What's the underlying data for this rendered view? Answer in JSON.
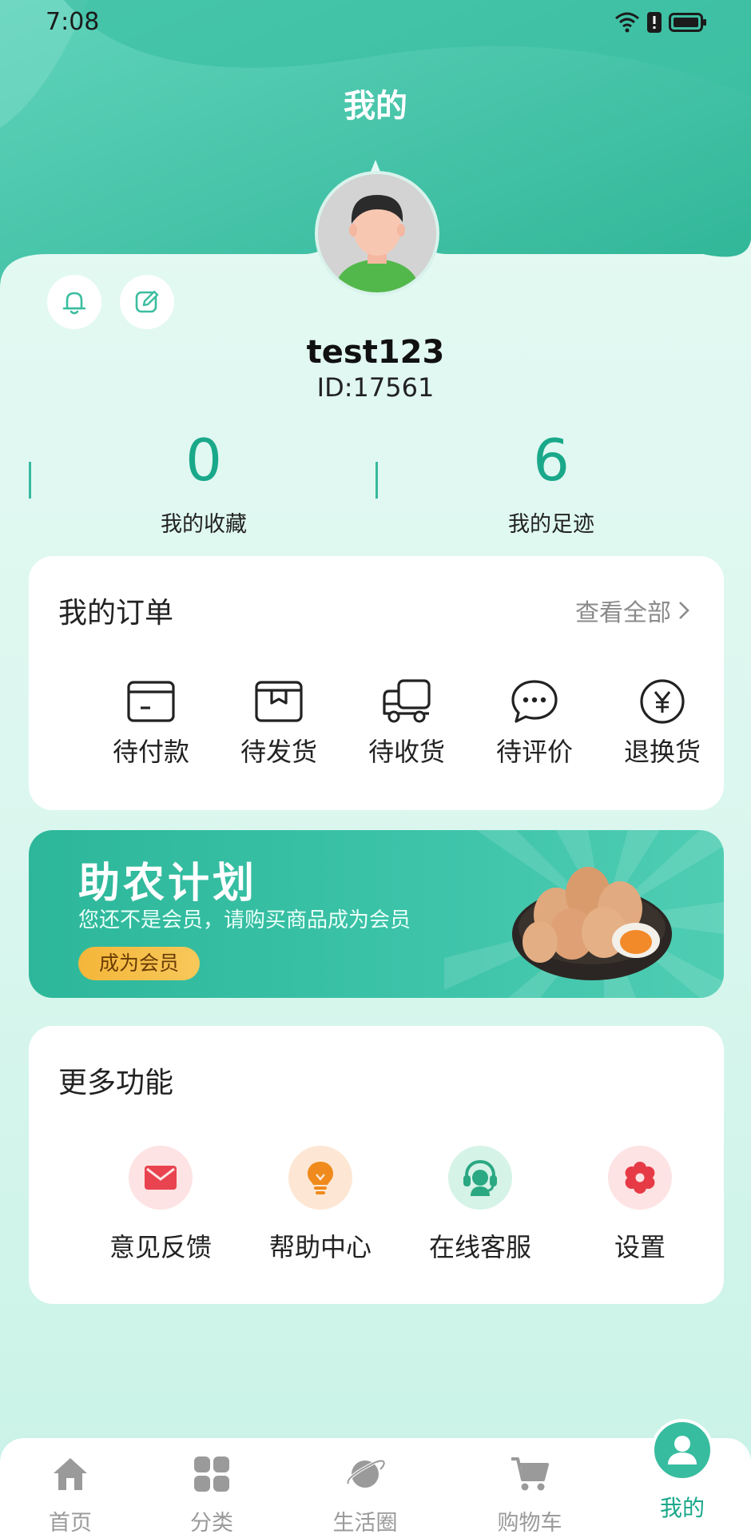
{
  "status_bar": {
    "time": "7:08"
  },
  "header": {
    "title": "我的"
  },
  "profile": {
    "username": "test123",
    "id_text": "ID:17561"
  },
  "stats": [
    {
      "value": "0",
      "label": "我的收藏"
    },
    {
      "value": "6",
      "label": "我的足迹"
    }
  ],
  "orders": {
    "title": "我的订单",
    "view_all": "查看全部",
    "items": [
      {
        "label": "待付款",
        "icon": "wallet-card-icon"
      },
      {
        "label": "待发货",
        "icon": "package-box-icon"
      },
      {
        "label": "待收货",
        "icon": "delivery-truck-icon"
      },
      {
        "label": "待评价",
        "icon": "chat-bubble-icon"
      },
      {
        "label": "退换货",
        "icon": "yen-refund-icon"
      }
    ]
  },
  "banner": {
    "title": "助农计划",
    "subtitle": "您还不是会员，请购买商品成为会员",
    "button": "成为会员"
  },
  "more": {
    "title": "更多功能",
    "items": [
      {
        "label": "意见反馈",
        "icon": "mail-icon",
        "color": "#e8434f",
        "bg": "#fde3e3"
      },
      {
        "label": "帮助中心",
        "icon": "lightbulb-icon",
        "color": "#f08a1c",
        "bg": "#fde7d4"
      },
      {
        "label": "在线客服",
        "icon": "headset-agent-icon",
        "color": "#2aa882",
        "bg": "#d6f3e8"
      },
      {
        "label": "设置",
        "icon": "gear-icon",
        "color": "#e63b46",
        "bg": "#fde3e3"
      }
    ]
  },
  "tabbar": {
    "items": [
      {
        "label": "首页",
        "icon": "home-icon"
      },
      {
        "label": "分类",
        "icon": "grid-icon"
      },
      {
        "label": "生活圈",
        "icon": "planet-icon"
      },
      {
        "label": "购物车",
        "icon": "cart-icon"
      },
      {
        "label": "我的",
        "icon": "user-icon",
        "active": true
      }
    ]
  },
  "colors": {
    "accent": "#1aa88a",
    "header": "#37bc9f"
  }
}
